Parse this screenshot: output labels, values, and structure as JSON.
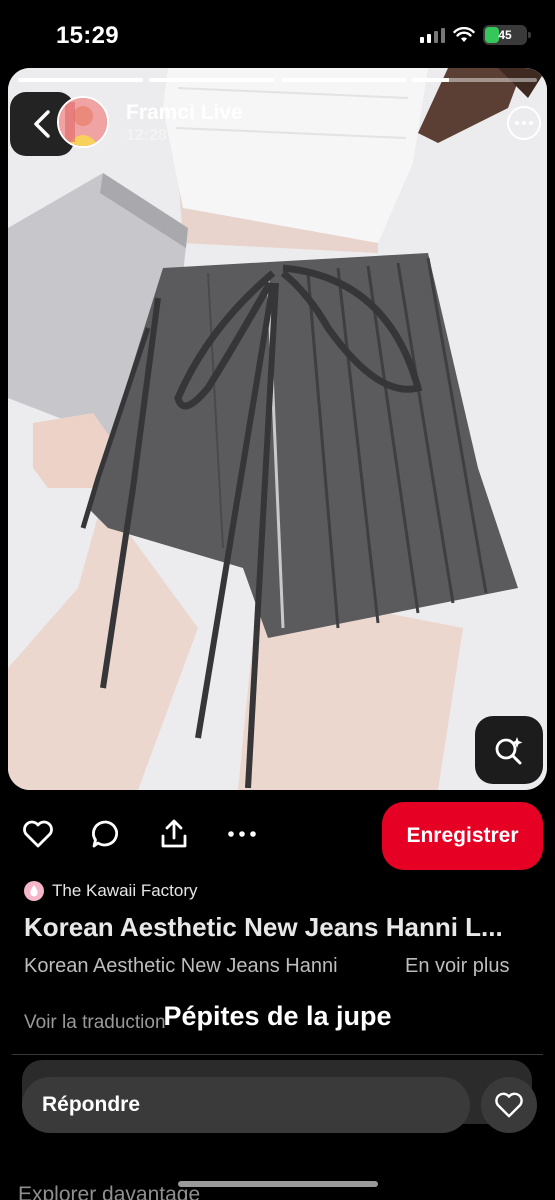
{
  "status_bar": {
    "time": "15:29",
    "battery": "45"
  },
  "story": {
    "channel_name": "Framci Live",
    "posted_time": "12:28",
    "progress": [
      1,
      1,
      1,
      0.3
    ]
  },
  "actions": {
    "save_label": "Enregistrer"
  },
  "pin": {
    "brand": "The Kawaii Factory",
    "title": "Korean Aesthetic New Jeans Hanni L...",
    "description": "Korean Aesthetic New Jeans Hanni",
    "see_more": "En voir plus",
    "translate": "Voir la traduction"
  },
  "story_caption": "Pépites de la jupe",
  "reply": {
    "placeholder": "Répondre"
  },
  "explore": "Explorer davantage",
  "colors": {
    "save_button": "#e60023",
    "background": "#000000"
  }
}
